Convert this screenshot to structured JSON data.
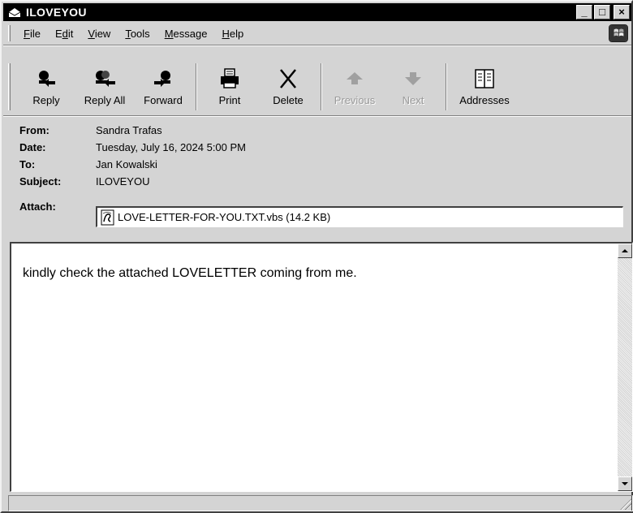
{
  "window": {
    "title": "ILOVEYOU",
    "controls": {
      "minimize": "_",
      "maximize": "□",
      "close": "×"
    }
  },
  "menu": {
    "items": [
      {
        "pre": "",
        "key": "F",
        "post": "ile"
      },
      {
        "pre": "E",
        "key": "d",
        "post": "it"
      },
      {
        "pre": "",
        "key": "V",
        "post": "iew"
      },
      {
        "pre": "",
        "key": "T",
        "post": "ools"
      },
      {
        "pre": "",
        "key": "M",
        "post": "essage"
      },
      {
        "pre": "",
        "key": "H",
        "post": "elp"
      }
    ]
  },
  "toolbar": {
    "reply": "Reply",
    "reply_all": "Reply All",
    "forward": "Forward",
    "print": "Print",
    "delete": "Delete",
    "previous": "Previous",
    "next": "Next",
    "addresses": "Addresses"
  },
  "headers": {
    "from_label": "From:",
    "from": "Sandra Trafas",
    "date_label": "Date:",
    "date": "Tuesday, July 16, 2024 5:00 PM",
    "to_label": "To:",
    "to": "Jan Kowalski",
    "subject_label": "Subject:",
    "subject": "ILOVEYOU",
    "attach_label": "Attach:",
    "attachment": "LOVE-LETTER-FOR-YOU.TXT.vbs (14.2 KB)"
  },
  "body": {
    "text": "kindly check the attached LOVELETTER coming from me."
  },
  "icons": {
    "reply": "reply-icon",
    "reply_all": "reply-all-icon",
    "forward": "forward-icon",
    "print": "printer-icon",
    "delete": "delete-x-icon",
    "previous": "up-arrow-icon",
    "next": "down-arrow-icon",
    "addresses": "address-book-icon"
  }
}
